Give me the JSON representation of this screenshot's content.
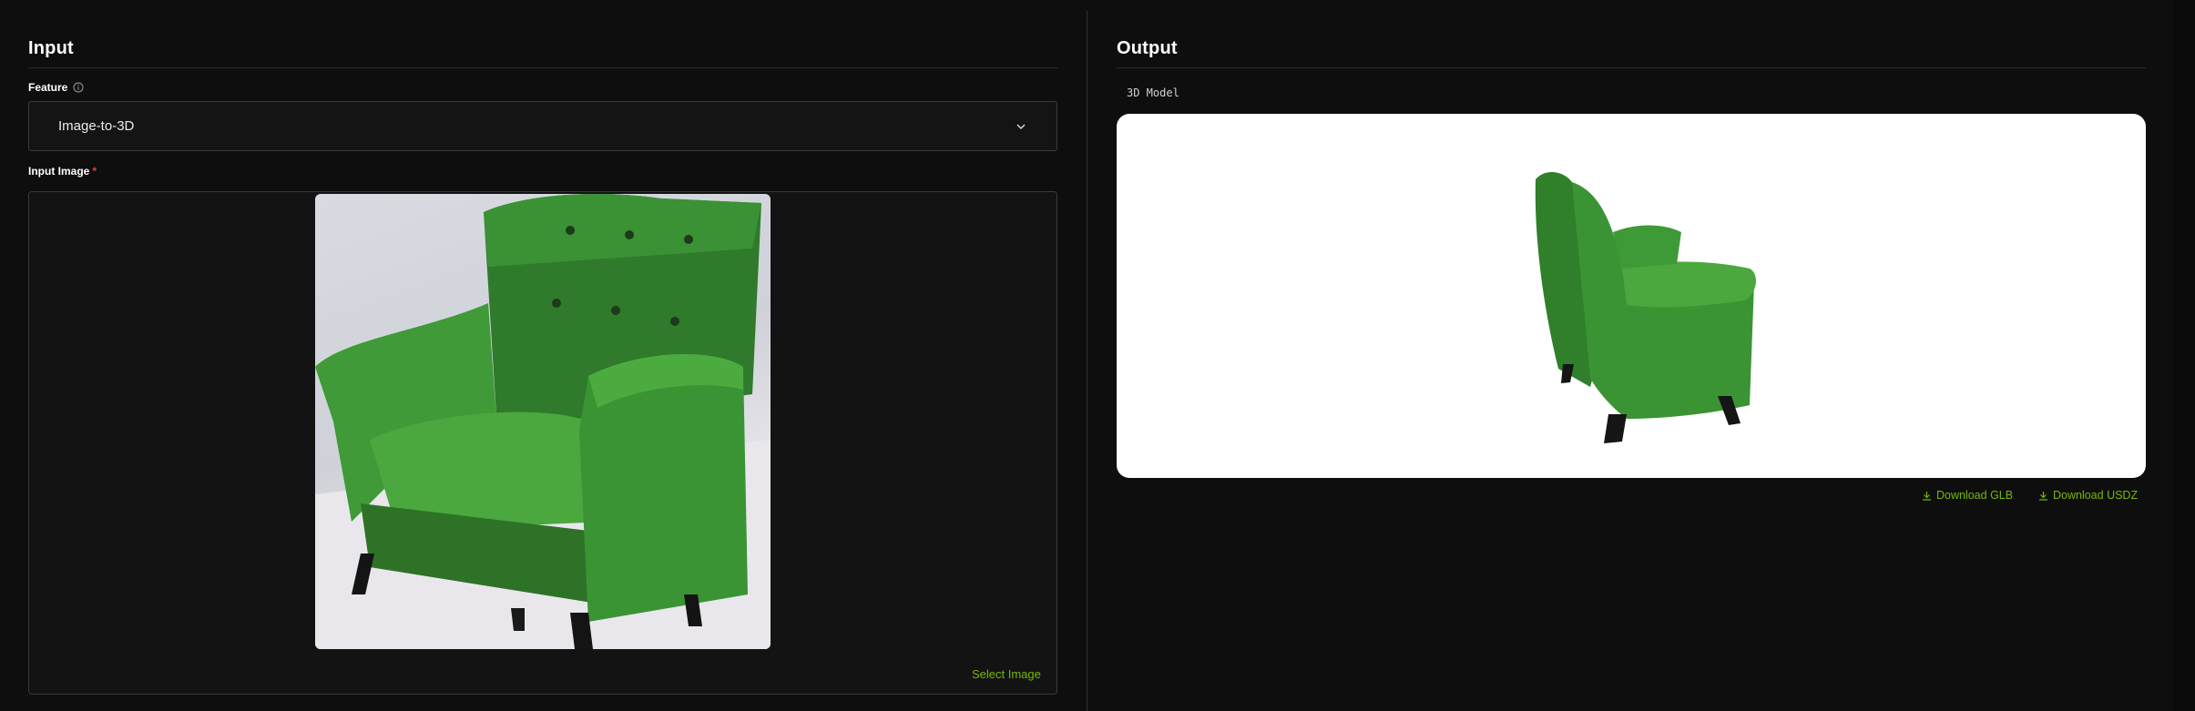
{
  "input_panel": {
    "title": "Input",
    "feature_label": "Feature",
    "feature_value": "Image-to-3D",
    "image_label": "Input Image",
    "required_marker": "*",
    "select_image_label": "Select Image"
  },
  "output_panel": {
    "title": "Output",
    "model_label": "3D Model",
    "download_glb_label": "Download GLB",
    "download_usdz_label": "Download USDZ"
  },
  "icons": {
    "info": "info-icon",
    "chevron": "chevron-down-icon",
    "download": "download-icon"
  },
  "colors": {
    "background": "#0e0e0e",
    "accent": "#76b900",
    "required": "#e0413a",
    "chair_green": "#3a8a2f"
  }
}
